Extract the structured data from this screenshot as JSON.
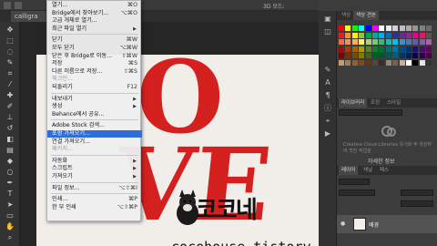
{
  "document_tab": {
    "title": "calligra"
  },
  "topbar": {
    "three_d_label": "3D 모드:"
  },
  "canvas": {
    "watermark_text": "코코네",
    "watermark_url": "cocohouse.tistory.com"
  },
  "file_menu": {
    "items": [
      {
        "label": "열기...",
        "shortcut": "⌘O"
      },
      {
        "label": "Bridge에서 찾아보기...",
        "shortcut": "⌥⌘O"
      },
      {
        "label": "고급 개체로 열기...",
        "shortcut": ""
      },
      {
        "label": "최근 파일 열기",
        "shortcut": "",
        "submenu": true
      },
      {
        "label": "닫기",
        "shortcut": "⌘W"
      },
      {
        "label": "모두 닫기",
        "shortcut": "⌥⌘W"
      },
      {
        "label": "닫은 후 Bridge로 이동...",
        "shortcut": "⇧⌘W"
      },
      {
        "label": "저장",
        "shortcut": "⌘S"
      },
      {
        "label": "다른 이름으로 저장...",
        "shortcut": "⇧⌘S"
      },
      {
        "label": "체크인...",
        "shortcut": "",
        "disabled": true
      },
      {
        "label": "되돌리기",
        "shortcut": "F12"
      },
      {
        "label": "내보내기",
        "shortcut": "",
        "submenu": true
      },
      {
        "label": "생성",
        "shortcut": "",
        "submenu": true
      },
      {
        "label": "Behance에서 공유...",
        "shortcut": ""
      },
      {
        "label": "Adobe Stock 검색...",
        "shortcut": ""
      },
      {
        "label": "포함 가져오기...",
        "shortcut": "",
        "highlight": true
      },
      {
        "label": "연결 가져오기...",
        "shortcut": ""
      },
      {
        "label": "패키지...",
        "shortcut": "",
        "disabled": true
      },
      {
        "label": "자동화",
        "shortcut": "",
        "submenu": true
      },
      {
        "label": "스크립트",
        "shortcut": "",
        "submenu": true
      },
      {
        "label": "가져오기",
        "shortcut": "",
        "submenu": true
      },
      {
        "label": "파일 정보...",
        "shortcut": "⌥⇧⌘I"
      },
      {
        "label": "인쇄...",
        "shortcut": "⌘P"
      },
      {
        "label": "한 부 인쇄",
        "shortcut": "⌥⇧⌘P"
      }
    ]
  },
  "panels": {
    "color_tabs": [
      "색상",
      "색상 견본"
    ],
    "library_tabs": [
      "라이브러리",
      "조정",
      "스타일"
    ],
    "library_message": "Creative Cloud Libraries 유기화 후 생성하여 멋진 작업을",
    "details_button": "자세한 정보",
    "layers_tabs": [
      "레이어",
      "채널",
      "패스"
    ],
    "layer_name": "배경"
  },
  "colors": {
    "accent": "#2f6ed9",
    "brand_red": "#d4201f",
    "panel_bg": "#3c3c3c"
  }
}
